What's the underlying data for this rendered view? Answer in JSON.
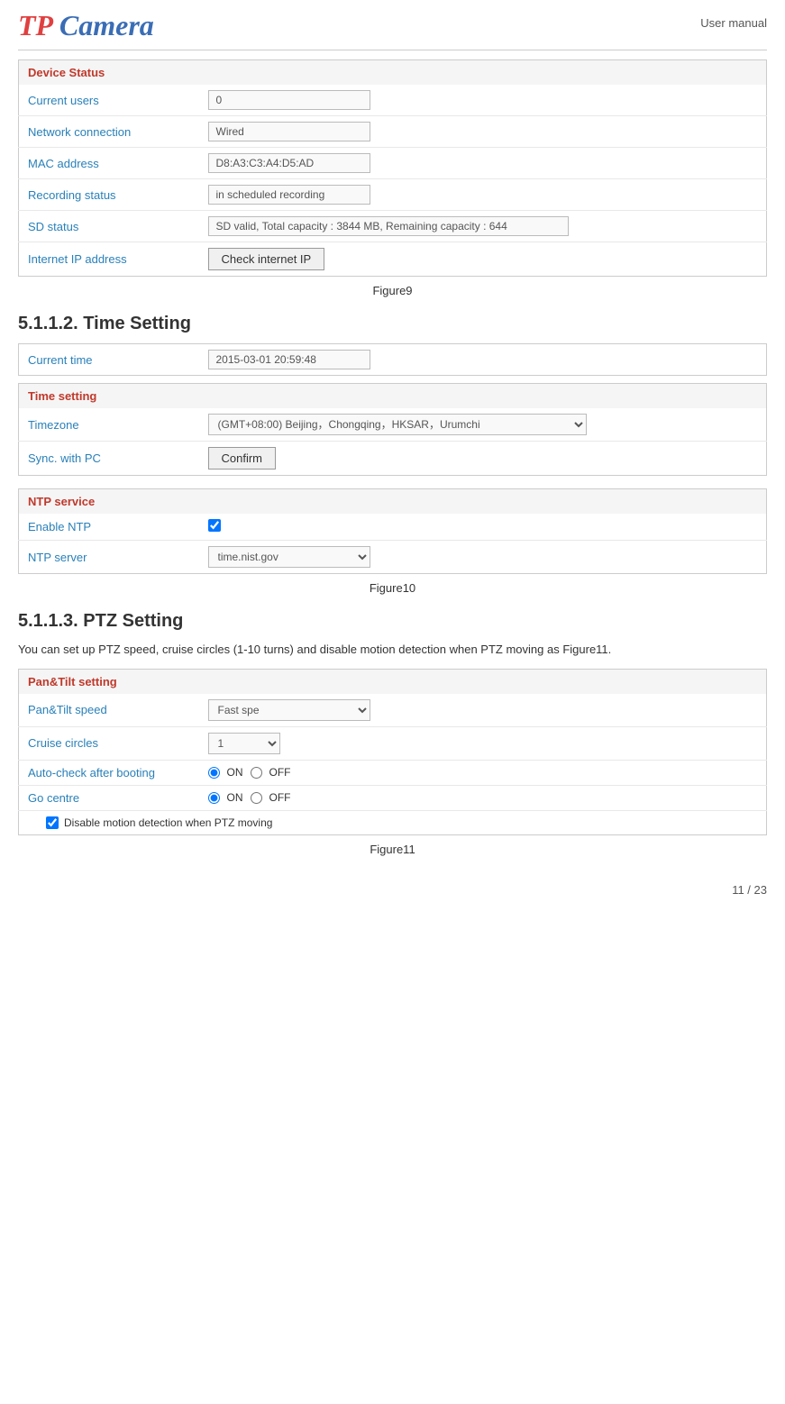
{
  "header": {
    "logo_tp": "TP",
    "logo_cam": " Camera",
    "user_manual": "User manual"
  },
  "device_status": {
    "section_title": "Device Status",
    "rows": [
      {
        "label": "Current users",
        "value": "0"
      },
      {
        "label": "Network connection",
        "value": "Wired"
      },
      {
        "label": "MAC address",
        "value": "D8:A3:C3:A4:D5:AD"
      },
      {
        "label": "Recording status",
        "value": "in scheduled recording"
      },
      {
        "label": "SD status",
        "value": "SD valid, Total capacity : 3844 MB, Remaining capacity : 644"
      },
      {
        "label": "Internet IP address",
        "value": null,
        "button": "Check internet IP"
      }
    ],
    "figure": "Figure9"
  },
  "time_setting_section": {
    "heading": "5.1.1.2. Time Setting",
    "current_time_label": "Current time",
    "current_time_value": "2015-03-01 20:59:48",
    "time_setting_title": "Time setting",
    "timezone_label": "Timezone",
    "timezone_value": "(GMT+08:00) Beijing，Chongqing，HKSAR，Urumchi",
    "sync_label": "Sync. with PC",
    "confirm_btn": "Confirm",
    "ntp_title": "NTP service",
    "enable_ntp_label": "Enable NTP",
    "ntp_server_label": "NTP server",
    "ntp_server_value": "time.nist.gov",
    "figure": "Figure10"
  },
  "ptz_section": {
    "heading": "5.1.1.3. PTZ Setting",
    "body_text": "You can set up PTZ speed, cruise circles (1-10 turns) and disable motion detection when PTZ moving as Figure11.",
    "pan_tilt_title": "Pan&Tilt setting",
    "pan_tilt_speed_label": "Pan&Tilt speed",
    "pan_tilt_speed_value": "Fast spe",
    "cruise_circles_label": "Cruise circles",
    "cruise_circles_value": "1",
    "auto_check_label": "Auto-check after booting",
    "auto_check_on": "ON",
    "auto_check_off": "OFF",
    "go_centre_label": "Go centre",
    "go_centre_on": "ON",
    "go_centre_off": "OFF",
    "disable_motion_label": "Disable motion detection when PTZ moving",
    "figure": "Figure11"
  },
  "page_number": "11 / 23"
}
